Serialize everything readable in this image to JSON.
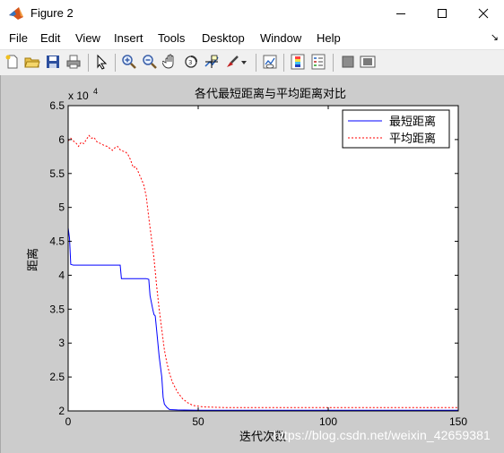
{
  "window": {
    "title": "Figure 2"
  },
  "menu": {
    "items": [
      "File",
      "Edit",
      "View",
      "Insert",
      "Tools",
      "Desktop",
      "Window",
      "Help"
    ],
    "overflow": "↘"
  },
  "toolbar": {
    "icons": [
      "new-figure-icon",
      "open-file-icon",
      "save-icon",
      "print-icon",
      "edit-plot-icon",
      "zoom-in-icon",
      "zoom-out-icon",
      "pan-icon",
      "rotate-3d-icon",
      "data-cursor-icon",
      "brush-icon",
      "brush-dropdown-icon",
      "link-plot-icon",
      "insert-colorbar-icon",
      "insert-legend-icon",
      "hide-plot-tools-icon",
      "show-plot-tools-icon"
    ]
  },
  "watermark": "https://blog.csdn.net/weixin_42659381",
  "chart_data": {
    "type": "line",
    "title": "各代最短距离与平均距离对比",
    "xlabel": "迭代次数",
    "ylabel": "距离",
    "y_exponent": "x 10^4",
    "y_exponent_base": "x 10",
    "y_exponent_power": "4",
    "xlim": [
      0,
      150
    ],
    "ylim": [
      20000,
      65000
    ],
    "xticks": [
      0,
      50,
      100,
      150
    ],
    "yticks": [
      2,
      2.5,
      3,
      3.5,
      4,
      4.5,
      5,
      5.5,
      6,
      6.5
    ],
    "grid": false,
    "legend_position": "top-right",
    "series": [
      {
        "name": "最短距离",
        "color": "#0000ff",
        "style": "solid",
        "points": [
          [
            0,
            47000
          ],
          [
            0.5,
            45500
          ],
          [
            1,
            41600
          ],
          [
            2,
            41500
          ],
          [
            20,
            41500
          ],
          [
            20.5,
            39500
          ],
          [
            30,
            39500
          ],
          [
            31,
            39400
          ],
          [
            31.5,
            37000
          ],
          [
            32.5,
            35000
          ],
          [
            33,
            34200
          ],
          [
            33.5,
            34000
          ],
          [
            34,
            32000
          ],
          [
            35,
            28000
          ],
          [
            36,
            25000
          ],
          [
            36.5,
            22000
          ],
          [
            37,
            21000
          ],
          [
            38,
            20500
          ],
          [
            39,
            20200
          ],
          [
            42,
            20150
          ],
          [
            50,
            20100
          ],
          [
            150,
            20100
          ]
        ]
      },
      {
        "name": "平均距离",
        "color": "#ff0000",
        "style": "dashed",
        "points": [
          [
            0,
            59800
          ],
          [
            1,
            60200
          ],
          [
            2,
            59800
          ],
          [
            3,
            59500
          ],
          [
            4,
            59000
          ],
          [
            5,
            59600
          ],
          [
            6,
            59400
          ],
          [
            7,
            60000
          ],
          [
            8,
            60600
          ],
          [
            9,
            60200
          ],
          [
            10,
            60300
          ],
          [
            11,
            59700
          ],
          [
            12,
            59500
          ],
          [
            13,
            59300
          ],
          [
            14,
            59100
          ],
          [
            15,
            59000
          ],
          [
            16,
            58700
          ],
          [
            17,
            58400
          ],
          [
            18,
            58800
          ],
          [
            19,
            59000
          ],
          [
            20,
            58500
          ],
          [
            21,
            58300
          ],
          [
            22,
            58200
          ],
          [
            23,
            57800
          ],
          [
            24,
            57000
          ],
          [
            25,
            55900
          ],
          [
            26,
            56000
          ],
          [
            27,
            55200
          ],
          [
            28,
            54300
          ],
          [
            29,
            53400
          ],
          [
            30,
            51700
          ],
          [
            31,
            48500
          ],
          [
            32,
            45500
          ],
          [
            33,
            42500
          ],
          [
            34,
            38500
          ],
          [
            35,
            35000
          ],
          [
            36,
            32000
          ],
          [
            37,
            29000
          ],
          [
            38,
            27000
          ],
          [
            39,
            25500
          ],
          [
            40,
            24300
          ],
          [
            42,
            22800
          ],
          [
            44,
            21800
          ],
          [
            46,
            21200
          ],
          [
            48,
            20800
          ],
          [
            52,
            20600
          ],
          [
            60,
            20500
          ],
          [
            150,
            20500
          ]
        ]
      }
    ]
  }
}
